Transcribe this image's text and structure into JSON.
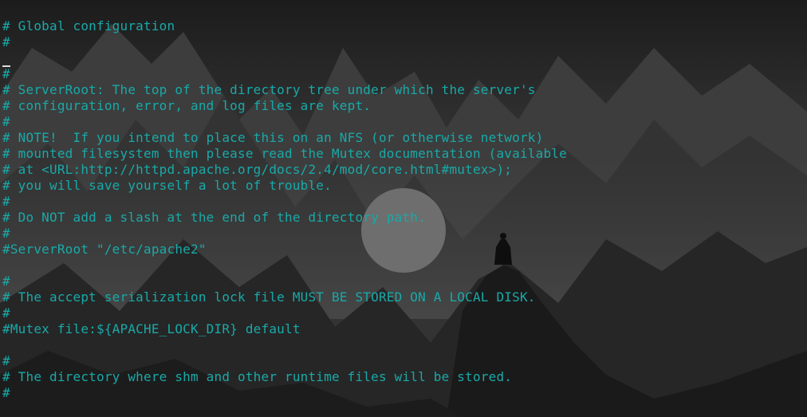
{
  "terminal": {
    "text_color": "#19a9a8",
    "background": "dark mountain landscape wallpaper",
    "lines": [
      "# Global configuration",
      "#",
      "",
      "#",
      "# ServerRoot: The top of the directory tree under which the server's",
      "# configuration, error, and log files are kept.",
      "#",
      "# NOTE!  If you intend to place this on an NFS (or otherwise network)",
      "# mounted filesystem then please read the Mutex documentation (available",
      "# at <URL:http://httpd.apache.org/docs/2.4/mod/core.html#mutex>);",
      "# you will save yourself a lot of trouble.",
      "#",
      "# Do NOT add a slash at the end of the directory path.",
      "#",
      "#ServerRoot \"/etc/apache2\"",
      "",
      "#",
      "# The accept serialization lock file MUST BE STORED ON A LOCAL DISK.",
      "#",
      "#Mutex file:${APACHE_LOCK_DIR} default",
      "",
      "#",
      "# The directory where shm and other runtime files will be stored.",
      "#"
    ]
  }
}
